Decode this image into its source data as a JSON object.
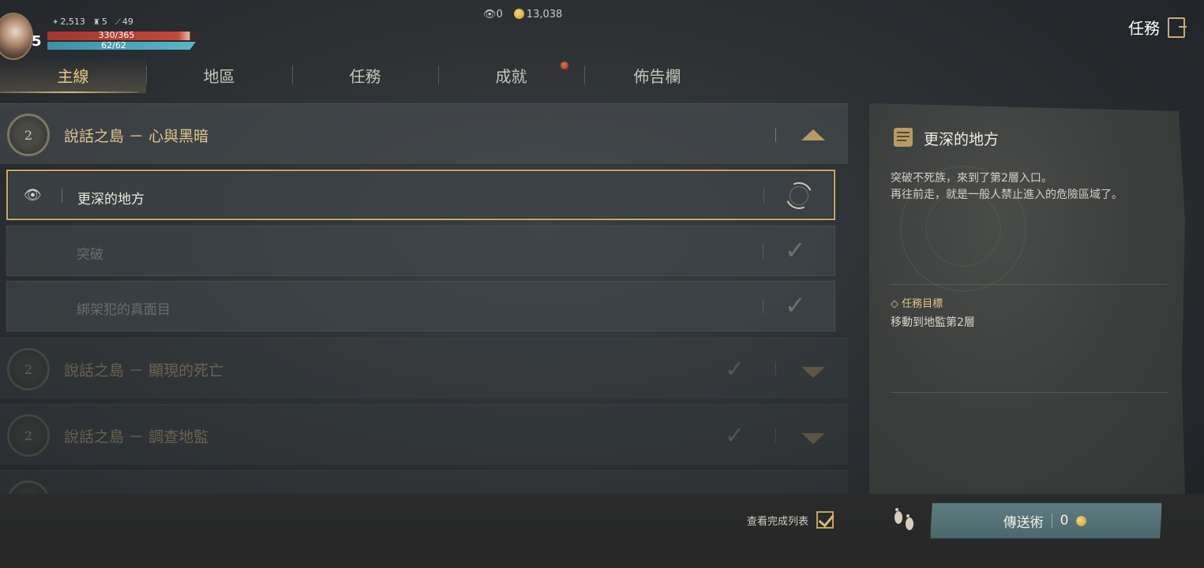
{
  "player": {
    "level": "5",
    "stat_1": "2,513",
    "stat_2": "5",
    "stat_3": "49",
    "hp_text": "330/365",
    "mp_text": "62/62",
    "hp_fraction": 0.904,
    "mp_fraction": 1.0
  },
  "currency": {
    "eye_count": "0",
    "gold": "13,038"
  },
  "header": {
    "title": "任務"
  },
  "tabs": [
    {
      "label": "主線",
      "active": true
    },
    {
      "label": "地區",
      "active": false
    },
    {
      "label": "任務",
      "active": false
    },
    {
      "label": "成就",
      "active": false,
      "notification": true
    },
    {
      "label": "佈告欄",
      "active": false
    }
  ],
  "chapters": [
    {
      "number": "2",
      "title": "說話之島 － 心與黑暗",
      "expanded": true,
      "completed": false
    },
    {
      "number": "2",
      "title": "說話之島 － 顯現的死亡",
      "expanded": false,
      "completed": true
    },
    {
      "number": "2",
      "title": "說話之島 － 調查地監",
      "expanded": false,
      "completed": true
    }
  ],
  "quests": [
    {
      "title": "更深的地方",
      "status": "in-progress",
      "tracked": true
    },
    {
      "title": "突破",
      "status": "completed"
    },
    {
      "title": "綁架犯的真面目",
      "status": "completed"
    }
  ],
  "bottom": {
    "view_completed_label": "查看完成列表",
    "view_completed_checked": true
  },
  "detail": {
    "title": "更深的地方",
    "description_line1": "突破不死族，來到了第2層入口。",
    "description_line2": "再往前走，就是一般人禁止進入的危險區域了。",
    "objective_label": "◇ 任務目標",
    "objective_text": "移動到地監第2層",
    "teleport_label": "傳送術",
    "teleport_cost": "0"
  },
  "colors": {
    "accent_gold": "#e2c58c",
    "highlight_border": "#c9a764",
    "teleport_button": "#56747a",
    "hp_bar": "#c4473a",
    "mp_bar": "#5bb6c8"
  },
  "icons": [
    "wing-icon",
    "helmet-icon",
    "feather-icon",
    "eye-icon",
    "coin-icon",
    "exit-icon",
    "scroll-icon",
    "footprints-icon",
    "check-icon",
    "chevron-up-icon",
    "chevron-down-icon",
    "progress-ring-icon"
  ]
}
